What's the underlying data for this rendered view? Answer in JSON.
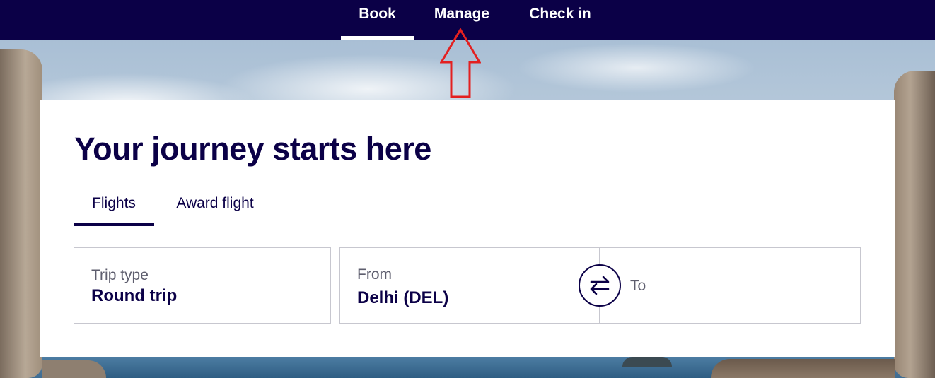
{
  "nav": {
    "items": [
      {
        "label": "Book",
        "active": true
      },
      {
        "label": "Manage",
        "active": false
      },
      {
        "label": "Check in",
        "active": false
      }
    ]
  },
  "booking": {
    "title": "Your journey starts here",
    "tabs": [
      {
        "label": "Flights",
        "active": true
      },
      {
        "label": "Award flight",
        "active": false
      }
    ],
    "trip_type": {
      "label": "Trip type",
      "value": "Round trip"
    },
    "from": {
      "label": "From",
      "value": "Delhi (DEL)"
    },
    "to": {
      "label": "To",
      "value": ""
    },
    "swap_icon": "swap-arrows-icon"
  },
  "colors": {
    "brand_navy": "#0b0047",
    "annotation_red": "#e32020"
  }
}
